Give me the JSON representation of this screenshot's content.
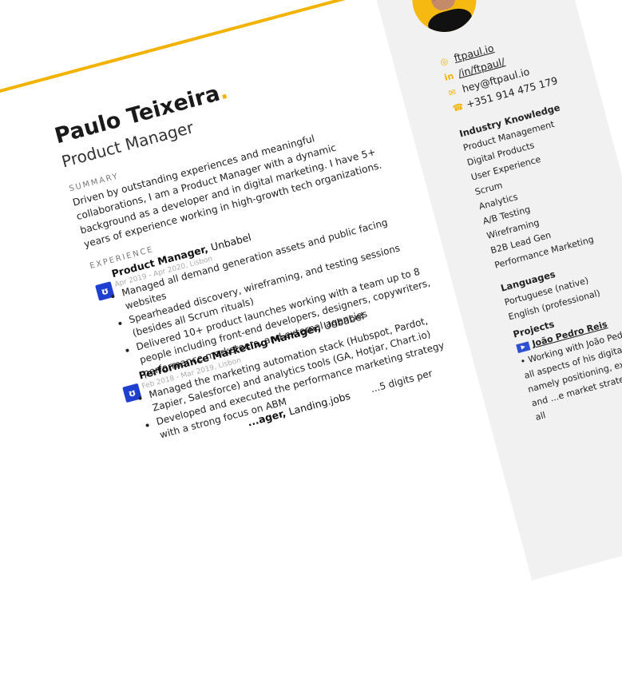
{
  "header": {
    "name": "Paulo Teixeira",
    "name_dot": ".",
    "role": "Product Manager"
  },
  "summary": {
    "label": "SUMMARY",
    "text": "Driven by outstanding experiences and meaningful collaborations, I am a Product Manager with a dynamic background as a developer and in digital marketing. I have 5+ years of experience working in high-growth tech organizations."
  },
  "experience": {
    "label": "EXPERIENCE",
    "jobs": [
      {
        "title": "Product Manager,",
        "company": "Unbabel",
        "date": "Apr 2019 - Apr 2020, Lisbon",
        "bullets": [
          "Managed all demand generation assets and public facing websites",
          "Spearheaded discovery, wireframing, and testing sessions (besides all Scrum rituals)",
          "Delivered 10+ product launches working with a team up to 8 people including front-end developers, designers, copywriters, performance marketeers, and external agencies"
        ]
      },
      {
        "title": "Performance Marketing Manager,",
        "company": "Unbabel",
        "date": "Feb 2018 - Mar 2019, Lisbon",
        "bullets": [
          "Managed the marketing automation stack (Hubspot, Pardot, Zapier, Salesforce) and analytics tools (GA, Hotjar, Chart.io)",
          "Developed and executed the performance marketing strategy with a strong focus on ABM"
        ]
      },
      {
        "title": "...ager,",
        "company": "Landing.jobs",
        "date": "",
        "bullets": [
          "...5 digits per"
        ]
      }
    ]
  },
  "contact": {
    "website": "ftpaul.io",
    "linkedin": "/in/ftpaul/",
    "email": "hey@ftpaul.io",
    "phone": "+351 914 475 179"
  },
  "industry_knowledge": {
    "label": "Industry Knowledge",
    "items": [
      "Product Management",
      "Digital Products",
      "User Experience",
      "Scrum",
      "Analytics",
      "A/B Testing",
      "Wireframing",
      "B2B Lead Gen",
      "Performance Marketing"
    ]
  },
  "languages": {
    "label": "Languages",
    "items": [
      "Portuguese (native)",
      "English (professional)"
    ]
  },
  "projects": {
    "label": "Projects",
    "name": "João Pedro Reis",
    "text": "• Working with João Pedro Reis on all aspects of his digital business, namely positioning, experience, and ...e market strategy ...eloping all"
  },
  "colors": {
    "accent": "#f2b200",
    "logo": "#1f3fd1",
    "sidebar": "#f1f1f1"
  },
  "icons": {
    "website": "globe-icon",
    "linkedin": "linkedin-icon",
    "email": "mail-icon",
    "phone": "phone-icon",
    "logo": "unbabel-logo-icon",
    "project": "play-icon"
  }
}
